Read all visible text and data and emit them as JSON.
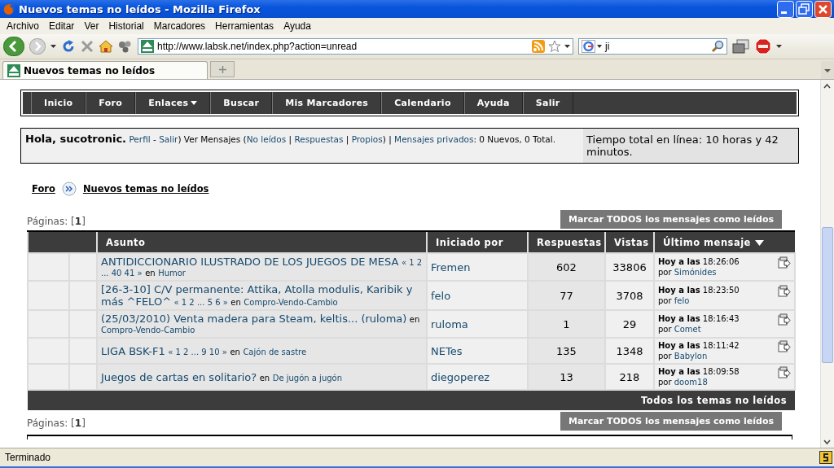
{
  "window": {
    "title": "Nuevos temas no leídos - Mozilla Firefox"
  },
  "menu": [
    {
      "label": "Archivo"
    },
    {
      "label": "Editar"
    },
    {
      "label": "Ver"
    },
    {
      "label": "Historial"
    },
    {
      "label": "Marcadores"
    },
    {
      "label": "Herramientas"
    },
    {
      "label": "Ayuda"
    }
  ],
  "address": {
    "value": "http://www.labsk.net/index.php?action=unread"
  },
  "search": {
    "value": "ji"
  },
  "tabs": [
    {
      "label": "Nuevos temas no leídos",
      "selected": true
    }
  ],
  "forum_nav": [
    {
      "label": "Inicio",
      "dropdown": false
    },
    {
      "label": "Foro",
      "dropdown": false
    },
    {
      "label": "Enlaces",
      "dropdown": true
    },
    {
      "label": "Buscar",
      "dropdown": false
    },
    {
      "label": "Mis Marcadores",
      "dropdown": false
    },
    {
      "label": "Calendario",
      "dropdown": false
    },
    {
      "label": "Ayuda",
      "dropdown": false
    },
    {
      "label": "Salir",
      "dropdown": false
    }
  ],
  "user_panel": {
    "segments": [
      {
        "kind": "bold",
        "text": "Hola, sucotronic."
      },
      {
        "kind": "link",
        "text": "Perfil"
      },
      {
        "kind": "text",
        "text": " - "
      },
      {
        "kind": "link",
        "text": "Salir"
      },
      {
        "kind": "text",
        "text": ") Ver Mensajes ("
      },
      {
        "kind": "link",
        "text": "No leídos"
      },
      {
        "kind": "text",
        "text": " | "
      },
      {
        "kind": "link",
        "text": "Respuestas"
      },
      {
        "kind": "text",
        "text": " | "
      },
      {
        "kind": "link",
        "text": "Propios"
      },
      {
        "kind": "text",
        "text": ") | "
      },
      {
        "kind": "link",
        "text": "Mensajes privados"
      },
      {
        "kind": "text",
        "text": ": 0 Nuevos, 0 Total."
      }
    ],
    "online_time": "Tiempo total en línea: 10 horas y 42 minutos."
  },
  "breadcrumb": [
    {
      "label": "Foro"
    },
    {
      "label": "Nuevos temas no leídos"
    }
  ],
  "pages_top": "Páginas: [**1**]",
  "mark_read_top": "Marcar TODOS los mensajes como leídos",
  "table": {
    "columns": [
      {
        "label": "Asunto",
        "sorted": false
      },
      {
        "label": "Iniciado por",
        "sorted": false
      },
      {
        "label": "Respuestas",
        "sorted": false
      },
      {
        "label": "Vistas",
        "sorted": false
      },
      {
        "label": "Último mensaje",
        "sorted": true
      }
    ],
    "rows": [
      {
        "subject": [
          {
            "kind": "title",
            "text": "ANTIDICCIONARIO ILUSTRADO DE LOS JUEGOS DE MESA"
          },
          {
            "kind": "pages",
            "text": "« 1 2 ... 40 41 »"
          },
          {
            "kind": "plain",
            "text": "en"
          },
          {
            "kind": "board",
            "text": "Humor"
          }
        ],
        "starter": "Fremen",
        "replies": "602",
        "views": "33806",
        "last_day": "Hoy a las",
        "last_time": "18:26:06",
        "last_by": "por",
        "last_user": "Simónides"
      },
      {
        "subject": [
          {
            "kind": "title",
            "text": "[26-3-10] C/V permanente: Attika, Atolla modulis, Karibik y más ^FELO^"
          },
          {
            "kind": "pages",
            "text": "« 1 2 ... 5 6 »"
          },
          {
            "kind": "plain",
            "text": "en"
          },
          {
            "kind": "board",
            "text": "Compro-Vendo-Cambio"
          }
        ],
        "starter": "felo",
        "replies": "77",
        "views": "3708",
        "last_day": "Hoy a las",
        "last_time": "18:23:50",
        "last_by": "por",
        "last_user": "felo"
      },
      {
        "subject": [
          {
            "kind": "title",
            "text": "(25/03/2010) Venta madera para Steam, keltis... (ruloma)"
          },
          {
            "kind": "plain",
            "text": "en"
          },
          {
            "kind": "board",
            "text": "Compro-Vendo-Cambio"
          }
        ],
        "starter": "ruloma",
        "replies": "1",
        "views": "29",
        "last_day": "Hoy a las",
        "last_time": "18:16:43",
        "last_by": "por",
        "last_user": "Comet"
      },
      {
        "subject": [
          {
            "kind": "title",
            "text": "LIGA BSK-F1"
          },
          {
            "kind": "pages",
            "text": "« 1 2 ... 9 10 »"
          },
          {
            "kind": "plain",
            "text": "en"
          },
          {
            "kind": "board",
            "text": "Cajón de sastre"
          }
        ],
        "starter": "NETes",
        "replies": "135",
        "views": "1348",
        "last_day": "Hoy a las",
        "last_time": "18:11:42",
        "last_by": "por",
        "last_user": "Babylon"
      },
      {
        "subject": [
          {
            "kind": "title",
            "text": "Juegos de cartas en solitario?"
          },
          {
            "kind": "plain",
            "text": "en"
          },
          {
            "kind": "board",
            "text": "De jugón a jugón"
          }
        ],
        "starter": "diegoperez",
        "replies": "13",
        "views": "218",
        "last_day": "Hoy a las",
        "last_time": "18:09:58",
        "last_by": "por",
        "last_user": "doom18"
      }
    ],
    "footer": "Todos los temas no leídos"
  },
  "pages_bottom": "Páginas: [**1**]",
  "mark_read_bottom": "Marcar TODOS los mensajes como leídos",
  "status_bar": {
    "text": "Terminado"
  }
}
